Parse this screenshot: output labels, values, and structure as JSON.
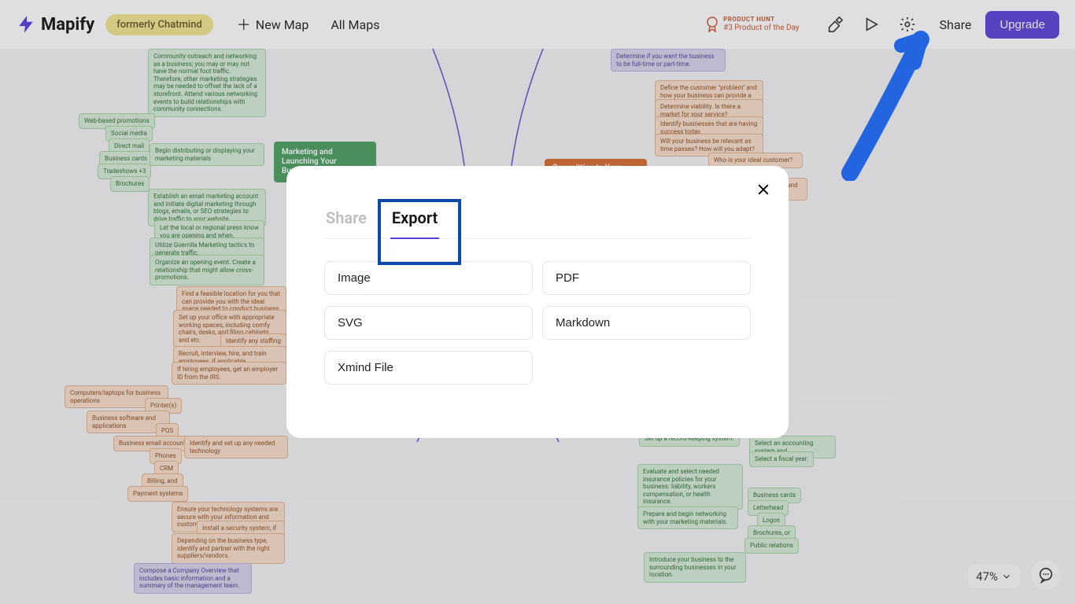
{
  "brand": {
    "name": "Mapify",
    "badge": "formerly Chatmind"
  },
  "nav": {
    "new_map": "New Map",
    "all_maps": "All Maps"
  },
  "product_hunt": {
    "line1": "PRODUCT HUNT",
    "line2": "#3 Product of the Day"
  },
  "header": {
    "share": "Share",
    "upgrade": "Upgrade"
  },
  "modal": {
    "tab_share": "Share",
    "tab_export": "Export",
    "options": {
      "image": "Image",
      "pdf": "PDF",
      "svg": "SVG",
      "markdown": "Markdown",
      "xmind": "Xmind File"
    }
  },
  "zoom": {
    "value": "47%"
  },
  "mindmap": {
    "marketing_title": "Marketing and Launching Your Business",
    "commit_title": "Committing to Your Business",
    "left_green_big": "Community outreach and networking as a business; you may or may not have the normal foot traffic. Therefore, other marketing strategies may be needed to offset the lack of a storefront. Attend various networking events to build relationships with community connections.",
    "left_green_1": "Web-based promotions",
    "left_green_2": "Social media",
    "left_green_3": "Direct mail",
    "left_green_4": "Business cards",
    "left_green_5": "Tradeshows +3",
    "left_green_6": "Brochures",
    "left_green_7": "Begin distributing or displaying your marketing materials",
    "left_green_8": "Establish an email marketing account and initiate digital marketing through blogs, emails, or SEO strategies to drive traffic to your website.",
    "left_green_9": "Let the local or regional press know you are opening and when.",
    "left_green_10": "Utilize Guerrilla Marketing tactics to generate traffic.",
    "left_green_11": "Organize an opening event. Create a relationship that might allow cross-promotions.",
    "left_orange_1": "Find a feasible location for you that can provide you with the ideal space needed to conduct business.",
    "left_orange_2": "Set up your office with appropriate working spaces, including comfy chairs, desks, and filing cabinets, and etc.",
    "left_orange_3": "Identify any staffing needs.",
    "left_orange_4": "Recruit, interview, hire, and train employees, if applicable.",
    "left_orange_5": "If hiring employees, get an employer ID from the IRS.",
    "left_orange_6": "Computers/laptops for business operations",
    "left_orange_7": "Printer(s)",
    "left_orange_8": "Business software and applications",
    "left_orange_9": "POS",
    "left_orange_10": "Business email accounts",
    "left_orange_11": "Identify and set up any needed technology",
    "left_orange_12": "Phones",
    "left_orange_13": "CRM",
    "left_orange_14": "Billing, and",
    "left_orange_15": "Payment systems",
    "left_orange_16": "Ensure your technology systems are secure with your information and customer information.",
    "left_orange_17": "Install a security system, if applicable.",
    "left_orange_18": "Depending on the business type, identify and partner with the right suppliers/vendors.",
    "left_purple_1": "Compose a Company Overview that includes basic information and a summary of the management team.",
    "right_purple_1": "Determine if you want the business to be full-time or part-time.",
    "right_orange_1": "Define the customer \"problem\" and how your business can provide a simple solution.",
    "right_orange_2": "Determine viability. Is there a market for your service?",
    "right_orange_3": "Identify businesses that are having success today.",
    "right_orange_4": "Will your business be relevant as time passes? How will you adapt?",
    "right_orange_5": "Who is your ideal customer?",
    "right_orange_6": "Understand your personal and business goals.",
    "right_green_1": "Select an accounting system and",
    "right_green_2": "Select a fiscal year.",
    "right_green_big": "Set up a record-keeping system.",
    "right_green_3": "Evaluate and select needed insurance policies for your business: liability, workers compensation, or health insurance.",
    "right_green_4": "Business cards",
    "right_green_5": "Letterhead",
    "right_green_6": "Logos",
    "right_green_7": "Brochures, or",
    "right_green_8": "Public relations",
    "right_green_9": "Prepare and begin networking with your marketing materials.",
    "right_green_10": "Introduce your business to the surrounding businesses in your location."
  }
}
